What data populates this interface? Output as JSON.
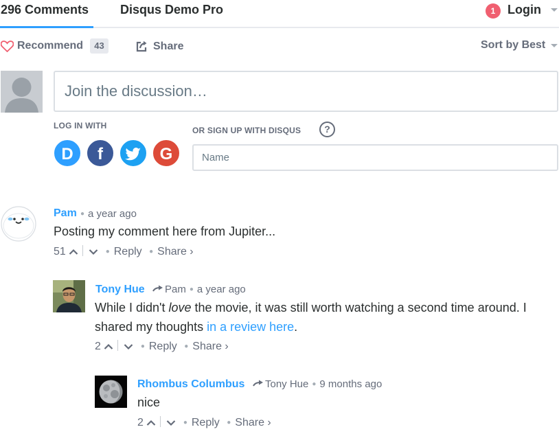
{
  "nav": {
    "comments_tab": "296 Comments",
    "forum_tab": "Disqus Demo Pro",
    "login_badge": "1",
    "login_label": "Login"
  },
  "actions": {
    "recommend_label": "Recommend",
    "recommend_count": "43",
    "share_label": "Share",
    "sort_label": "Sort by Best"
  },
  "composer": {
    "placeholder": "Join the discussion…",
    "login_with": "LOG IN WITH",
    "signup_with": "OR SIGN UP WITH DISQUS",
    "help": "?",
    "name_placeholder": "Name",
    "social": [
      {
        "label": "D",
        "icon": "disqus-icon"
      },
      {
        "label": "f",
        "icon": "facebook-icon"
      },
      {
        "label": "t",
        "icon": "twitter-icon"
      },
      {
        "label": "G",
        "icon": "google-icon"
      }
    ]
  },
  "comments": [
    {
      "author": "Pam",
      "reply_to": "",
      "time": "a year ago",
      "text": "Posting my comment here from Jupiter...",
      "votes": "51",
      "reply": "Reply",
      "share": "Share ›",
      "avatar": "smiley-cloud-avatar"
    },
    {
      "author": "Tony Hue",
      "reply_to": "Pam",
      "time": "a year ago",
      "text_before": "While I didn't ",
      "text_em": "love",
      "text_mid": " the movie, it was still worth watching a second time around. I shared my thoughts ",
      "link": "in a review here",
      "text_after": ".",
      "votes": "2",
      "reply": "Reply",
      "share": "Share ›",
      "avatar": "photo-avatar"
    },
    {
      "author": "Rhombus Columbus",
      "reply_to": "Tony Hue",
      "time": "9 months ago",
      "text": "nice",
      "votes": "2",
      "reply": "Reply",
      "share": "Share ›",
      "avatar": "moon-avatar"
    }
  ],
  "colors": {
    "accent": "#2e9fff",
    "badge": "#f05f70",
    "muted": "#656c7a"
  }
}
